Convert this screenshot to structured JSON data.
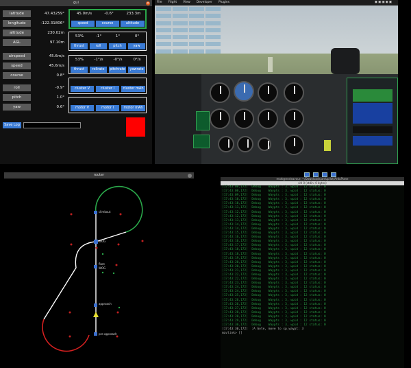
{
  "gui": {
    "title": "gui",
    "close_icon": "×",
    "rows": [
      {
        "label": "latitude",
        "value": "47.43259°"
      },
      {
        "label": "longitude",
        "value": "-122.31806°"
      },
      {
        "label": "altitude",
        "value": "230.02m"
      },
      {
        "label": "AGL",
        "value": "97.10m"
      },
      {
        "label": "airspeed",
        "value": "45.6m/s"
      },
      {
        "label": "speed",
        "value": "45.6m/s"
      },
      {
        "label": "course",
        "value": "0.8°"
      },
      {
        "label": "roll",
        "value": "-0.9°"
      },
      {
        "label": "pitch",
        "value": "1.0°"
      },
      {
        "label": "yaw",
        "value": "0.6°"
      }
    ],
    "group1": {
      "values": [
        "45.0m/s",
        "-0.6°",
        "233.3m"
      ],
      "buttons": [
        "speed",
        "course",
        "altitude"
      ]
    },
    "group2": {
      "values": [
        "53%",
        "-1°",
        "1°",
        "0°"
      ],
      "buttons": [
        "thrust",
        "roll",
        "pitch",
        "yaw"
      ]
    },
    "group3": {
      "values": [
        "53%",
        "-1°/s",
        "-0°/s",
        "0°/s"
      ],
      "buttons": [
        "thrust",
        "rollrate",
        "pitchrate",
        "yawrate"
      ]
    },
    "group4": {
      "buttons": [
        "cluster V",
        "cluster I",
        "cluster mAh"
      ]
    },
    "group5": {
      "buttons": [
        "motor V",
        "motor I",
        "motor mAh"
      ]
    },
    "save_log": "Save Log",
    "indicator_color": "#ff0000"
  },
  "sim": {
    "menu": [
      "File",
      "Flight",
      "View",
      "Developer",
      "Plugins"
    ]
  },
  "router": {
    "title": "router",
    "waypoints": [
      "climbout",
      "WOG",
      "flare",
      "WOG",
      "approach",
      "pre-approach"
    ]
  },
  "terminal": {
    "title": "matt@endeavour: ~/Downloads/ardupilot/ArduPlane",
    "tab": "sitl  0  (stdin: 0 bytes)",
    "lines": [
      "[17:43:08,172]  Debug    Waypts : 3, wpid : 12 status: 0",
      "[17:43:08,172]  Debug    Waypts : 3, wpid : 12 status: 0",
      "[17:43:09,172]  Debug    Waypts : 3, wpid : 12 status: 0",
      "[17:43:10,172]  Debug    Waypts : 3, wpid : 12 status: 0",
      "[17:43:10,172]  Debug    Waypts : 3, wpid : 12 status: 0",
      "[17:43:11,172]  Debug    Waypts : 3, wpid : 12 status: 0",
      "[17:43:12,172]  Debug    Waypts : 3, wpid : 12 status: 0",
      "[17:43:12,172]  Debug    Waypts : 3, wpid : 12 status: 0",
      "[17:43:13,172]  Debug    Waypts : 3, wpid : 12 status: 0",
      "[17:43:14,172]  Debug    Waypts : 3, wpid : 12 status: 0",
      "[17:43:14,172]  Debug    Waypts : 3, wpid : 12 status: 0",
      "[17:43:15,172]  Debug    Waypts : 3, wpid : 12 status: 0",
      "[17:43:16,172]  Debug    Waypts : 3, wpid : 12 status: 0",
      "[17:43:16,172]  Debug    Waypts : 3, wpid : 12 status: 0",
      "[17:43:17,172]  Debug    Waypts : 3, wpid : 12 status: 0",
      "[17:43:18,172]  Debug    Waypts : 3, wpid : 12 status: 0",
      "[17:43:18,172]  Debug    Waypts : 3, wpid : 12 status: 0",
      "[17:43:19,172]  Debug    Waypts : 3, wpid : 12 status: 0",
      "[17:43:20,172]  Debug    Waypts : 3, wpid : 12 status: 0",
      "[17:43:20,172]  Debug    Waypts : 3, wpid : 12 status: 0",
      "[17:43:21,172]  Debug    Waypts : 3, wpid : 12 status: 0",
      "[17:43:22,172]  Debug    Waypts : 3, wpid : 12 status: 0",
      "[17:43:22,172]  Debug    Waypts : 3, wpid : 12 status: 0",
      "[17:43:23,172]  Debug    Waypts : 3, wpid : 12 status: 0",
      "[17:43:24,172]  Debug    Waypts : 3, wpid : 12 status: 0",
      "[17:43:24,172]  Debug    Waypts : 3, wpid : 12 status: 0",
      "[17:43:25,172]  Debug    Waypts : 3, wpid : 12 status: 0",
      "[17:43:26,172]  Debug    Waypts : 3, wpid : 12 status: 0",
      "[17:43:26,172]  Debug    Waypts : 3, wpid : 12 status: 0",
      "[17:43:27,172]  Debug    Waypts : 3, wpid : 12 status: 0",
      "[17:43:28,172]  Debug    Waypts : 3, wpid : 12 status: 0",
      "[17:43:28,172]  Debug    Waypts : 3, wpid : 12 status: 0",
      "[17:43:29,172]  Debug    Waypts : 3, wpid : 12 status: 0",
      "[17:43:30,172]  Debug    Waypts : 3, wpid : 12 status: 0"
    ],
    "lines_tail": [
      "[17:43:30,172]  :A Gote, move to sp_waypt: 3"
    ],
    "prompt": "mavlink> []"
  }
}
